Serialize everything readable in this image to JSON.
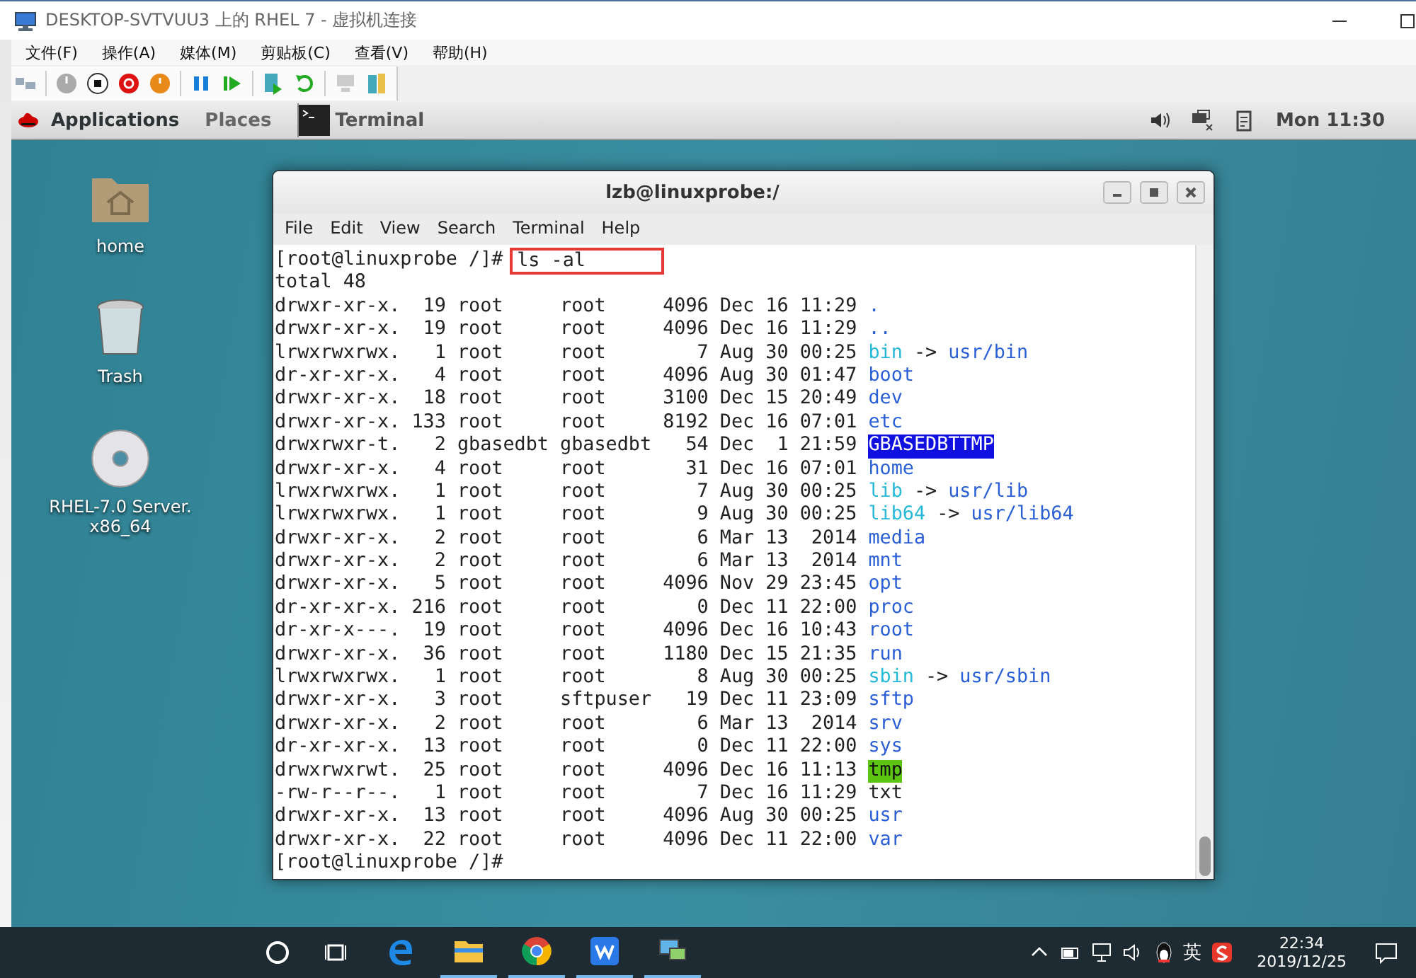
{
  "window": {
    "title": "DESKTOP-SVTVUU3 上的 RHEL 7 - 虚拟机连接"
  },
  "menu": [
    "文件(F)",
    "操作(A)",
    "媒体(M)",
    "剪贴板(C)",
    "查看(V)",
    "帮助(H)"
  ],
  "top_bar": {
    "applications": "Applications",
    "places": "Places",
    "task": "Terminal",
    "clock": "Mon 11:30"
  },
  "desktop_icons": [
    {
      "kind": "home",
      "label": "home"
    },
    {
      "kind": "trash",
      "label": "Trash"
    },
    {
      "kind": "disc",
      "label": "RHEL-7.0 Server. x86_64"
    }
  ],
  "terminal": {
    "title": "lzb@linuxprobe:/",
    "menu": [
      "File",
      "Edit",
      "View",
      "Search",
      "Terminal",
      "Help"
    ],
    "prompt": "[root@linuxprobe /]#",
    "command": "ls -al",
    "total": "total 48",
    "rows": [
      {
        "info": "drwxr-xr-x.  19 root     root     4096 Dec 16 11:29",
        "name": ".",
        "kind": "dir"
      },
      {
        "info": "drwxr-xr-x.  19 root     root     4096 Dec 16 11:29",
        "name": "..",
        "kind": "dir"
      },
      {
        "info": "lrwxrwxrwx.   1 root     root        7 Aug 30 00:25",
        "name": "bin",
        "kind": "link",
        "arrow": "->",
        "target": "usr/bin"
      },
      {
        "info": "dr-xr-xr-x.   4 root     root     4096 Aug 30 01:47",
        "name": "boot",
        "kind": "dir"
      },
      {
        "info": "drwxr-xr-x.  18 root     root     3100 Dec 15 20:49",
        "name": "dev",
        "kind": "dir"
      },
      {
        "info": "drwxr-xr-x. 133 root     root     8192 Dec 16 07:01",
        "name": "etc",
        "kind": "dir"
      },
      {
        "info": "drwxrwxr-t.   2 gbasedbt gbasedbt   54 Dec  1 21:59",
        "name": "GBASEDBTTMP",
        "kind": "other_writable"
      },
      {
        "info": "drwxr-xr-x.   4 root     root       31 Dec 16 07:01",
        "name": "home",
        "kind": "dir"
      },
      {
        "info": "lrwxrwxrwx.   1 root     root        7 Aug 30 00:25",
        "name": "lib",
        "kind": "link",
        "arrow": "->",
        "target": "usr/lib"
      },
      {
        "info": "lrwxrwxrwx.   1 root     root        9 Aug 30 00:25",
        "name": "lib64",
        "kind": "link",
        "arrow": "->",
        "target": "usr/lib64"
      },
      {
        "info": "drwxr-xr-x.   2 root     root        6 Mar 13  2014",
        "name": "media",
        "kind": "dir"
      },
      {
        "info": "drwxr-xr-x.   2 root     root        6 Mar 13  2014",
        "name": "mnt",
        "kind": "dir"
      },
      {
        "info": "drwxr-xr-x.   5 root     root     4096 Nov 29 23:45",
        "name": "opt",
        "kind": "dir"
      },
      {
        "info": "dr-xr-xr-x. 216 root     root        0 Dec 11 22:00",
        "name": "proc",
        "kind": "dir"
      },
      {
        "info": "dr-xr-x---.  19 root     root     4096 Dec 16 10:43",
        "name": "root",
        "kind": "dir"
      },
      {
        "info": "drwxr-xr-x.  36 root     root     1180 Dec 15 21:35",
        "name": "run",
        "kind": "dir"
      },
      {
        "info": "lrwxrwxrwx.   1 root     root        8 Aug 30 00:25",
        "name": "sbin",
        "kind": "link",
        "arrow": "->",
        "target": "usr/sbin"
      },
      {
        "info": "drwxr-xr-x.   3 root     sftpuser   19 Dec 11 23:09",
        "name": "sftp",
        "kind": "dir"
      },
      {
        "info": "drwxr-xr-x.   2 root     root        6 Mar 13  2014",
        "name": "srv",
        "kind": "dir"
      },
      {
        "info": "dr-xr-xr-x.  13 root     root        0 Dec 11 22:00",
        "name": "sys",
        "kind": "dir"
      },
      {
        "info": "drwxrwxrwt.  25 root     root     4096 Dec 16 11:13",
        "name": "tmp",
        "kind": "sticky"
      },
      {
        "info": "-rw-r--r--.   1 root     root        7 Dec 16 11:29",
        "name": "txt",
        "kind": "file"
      },
      {
        "info": "drwxr-xr-x.  13 root     root     4096 Aug 30 00:25",
        "name": "usr",
        "kind": "dir"
      },
      {
        "info": "drwxr-xr-x.  22 root     root     4096 Dec 11 22:00",
        "name": "var",
        "kind": "dir"
      }
    ],
    "end_prompt": "[root@linuxprobe /]#"
  },
  "taskbar": {
    "apps": [
      {
        "kind": "edge",
        "running": false
      },
      {
        "kind": "explorer",
        "running": true
      },
      {
        "kind": "chrome",
        "running": true
      },
      {
        "kind": "wps",
        "running": true
      },
      {
        "kind": "vm",
        "running": true
      }
    ],
    "ime": "英",
    "time": "22:34",
    "date": "2019/12/25"
  }
}
